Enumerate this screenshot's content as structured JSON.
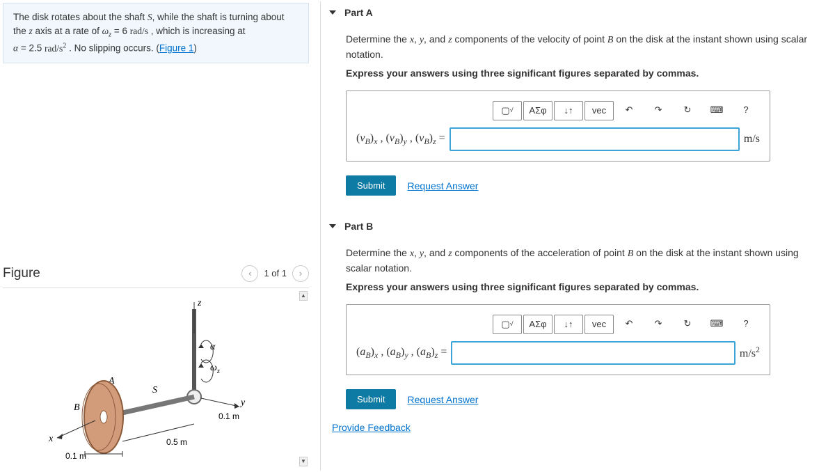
{
  "problem": {
    "line1a": "The disk rotates about the shaft ",
    "S": "S",
    "line1b": ", while the shaft is turning about",
    "line2a": "the ",
    "z": "z",
    "line2b": " axis at a rate of ",
    "wz": "ω",
    "wz_sub": "z",
    "eq1": " = 6 ",
    "unit1": "rad/s",
    "line2c": " , which is increasing at",
    "alpha": "α",
    "eq2": " = 2.5 ",
    "unit2a": "rad/s",
    "exp2": "2",
    "line3a": " . No slipping occurs. (",
    "figlink": "Figure 1",
    "line3b": ")"
  },
  "figure": {
    "title": "Figure",
    "pager": "1 of 1",
    "labels": {
      "z": "z",
      "alpha": "α",
      "wz": "ωz",
      "A": "A",
      "S": "S",
      "B": "B",
      "x": "x",
      "y": "y",
      "d1": "0.1 m",
      "d2": "0.5 m",
      "d3": "0.1 m"
    }
  },
  "partA": {
    "title": "Part A",
    "q1": "Determine the ",
    "x": "x",
    "c1": ", ",
    "y": "y",
    "c2": ", and ",
    "z": "z",
    "q2": " components of the velocity of point ",
    "B": "B",
    "q3": " on the disk at the instant shown using scalar notation.",
    "instr": "Express your answers using three significant figures separated by commas.",
    "prefix_full": "(vB)x , (vB)y , (vB)z =",
    "unit": "m/s",
    "submit": "Submit",
    "request": "Request Answer"
  },
  "partB": {
    "title": "Part B",
    "q1": "Determine the ",
    "x": "x",
    "c1": ", ",
    "y": "y",
    "c2": ", and ",
    "z": "z",
    "q2": " components of the acceleration of point ",
    "B": "B",
    "q3": " on the disk at the instant shown using scalar notation.",
    "instr": "Express your answers using three significant figures separated by commas.",
    "prefix_full": "(aB)x , (aB)y , (aB)z =",
    "unit": "m/s²",
    "submit": "Submit",
    "request": "Request Answer"
  },
  "toolbar": {
    "template": "▢",
    "sqrt": "√",
    "greek": "ΑΣφ",
    "subscript": "↓↑",
    "vec": "vec",
    "undo": "↶",
    "redo": "↷",
    "reset": "↻",
    "keyboard": "⌨",
    "help": "?"
  },
  "feedback": "Provide Feedback"
}
